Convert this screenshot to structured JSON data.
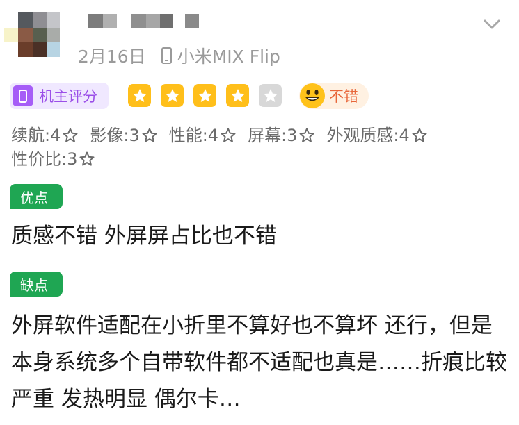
{
  "review": {
    "date": "2月16日",
    "device": "小米MIX Flip",
    "owner_badge": "机主评分",
    "rating": 4,
    "rating_max": 5,
    "mood": "不错",
    "scores": [
      {
        "label": "续航:4"
      },
      {
        "label": "影像:3"
      },
      {
        "label": "性能:4"
      },
      {
        "label": "屏幕:3"
      },
      {
        "label": "外观质感:4"
      },
      {
        "label": "性价比:3"
      }
    ],
    "pros_tag": "优点",
    "pros_text": "质感不错 外屏屏占比也不错",
    "cons_tag": "缺点",
    "cons_text": "外屏软件适配在小折里不算好也不算坏 还行，但是本身系统多个自带软件都不适配也真是……折痕比较严重 发热明显 偶尔卡…"
  },
  "colors": {
    "star_on": "#ffbf1a",
    "star_off": "#d8d8d8",
    "owner_badge": "#a65df7",
    "tag_green": "#1fa653",
    "mood_text": "#e8663a"
  }
}
